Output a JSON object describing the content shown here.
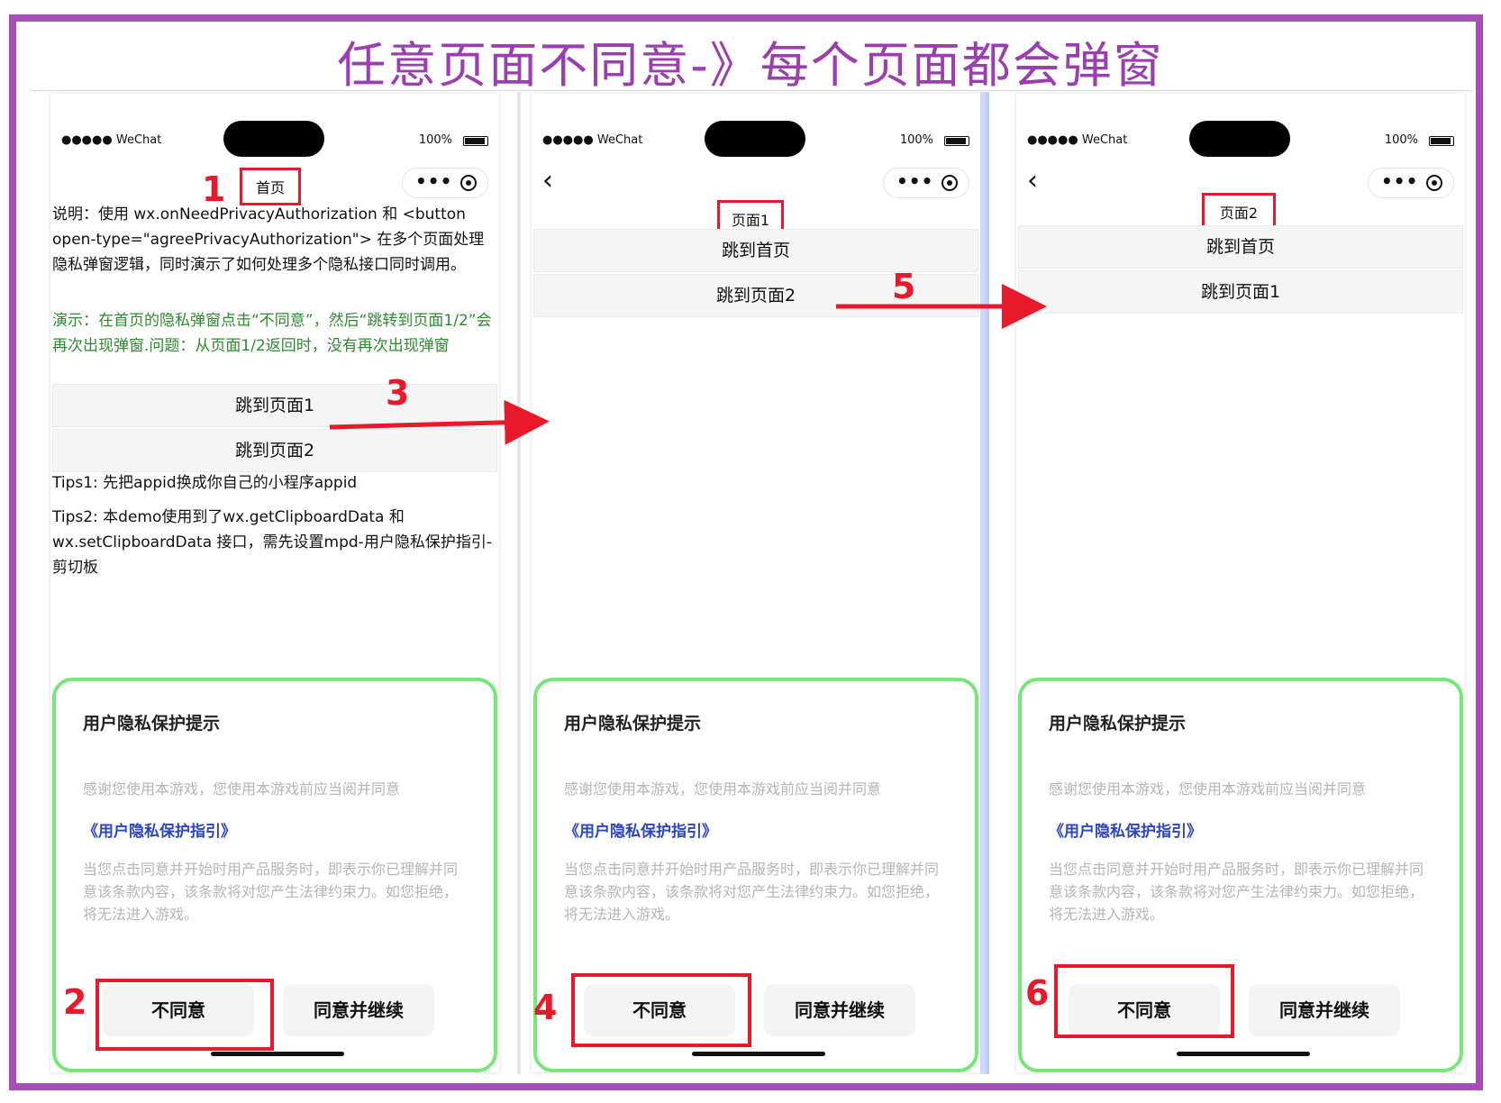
{
  "header": {
    "title": "任意页面不同意-》每个页面都会弹窗"
  },
  "status_bar": {
    "carrier": "●●●●● WeChat",
    "battery": "100%"
  },
  "capsule": {
    "more_icon": "more-dots-icon",
    "close_icon": "target-icon"
  },
  "screens": [
    {
      "page_title": "首页",
      "description": "说明：使用 wx.onNeedPrivacyAuthorization 和 <button open-type=\"agreePrivacyAuthorization\"> 在多个页面处理隐私弹窗逻辑，同时演示了如何处理多个隐私接口同时调用。",
      "demo_text": "演示：在首页的隐私弹窗点击“不同意”，然后“跳转到页面1/2”会再次出现弹窗.问题：从页面1/2返回时，没有再次出现弹窗",
      "buttons": [
        "跳到页面1",
        "跳到页面2"
      ],
      "tips1": "Tips1: 先把appid换成你自己的小程序appid",
      "tips2": "Tips2: 本demo使用到了wx.getClipboardData 和 wx.setClipboardData 接口，需先设置mpd-用户隐私保护指引-剪切板"
    },
    {
      "page_title": "页面1",
      "buttons": [
        "跳到首页",
        "跳到页面2"
      ]
    },
    {
      "page_title": "页面2",
      "buttons": [
        "跳到首页",
        "跳到页面1"
      ]
    }
  ],
  "modal": {
    "title": "用户隐私保护提示",
    "intro": "感谢您使用本游戏，您使用本游戏前应当阅并同意",
    "link": "《用户隐私保护指引》",
    "body": "当您点击同意并开始时用产品服务时，即表示你已理解并同意该条款内容，该条款将对您产生法律约束力。如您拒绝，将无法进入游戏。",
    "disagree_label": "不同意",
    "agree_label": "同意并继续"
  },
  "steps": [
    "1",
    "2",
    "3",
    "4",
    "5",
    "6"
  ],
  "colors": {
    "accent_purple": "#a64fb5",
    "annotation_red": "#e8192b",
    "modal_border": "#78e678",
    "link_blue": "#2b45c9"
  }
}
